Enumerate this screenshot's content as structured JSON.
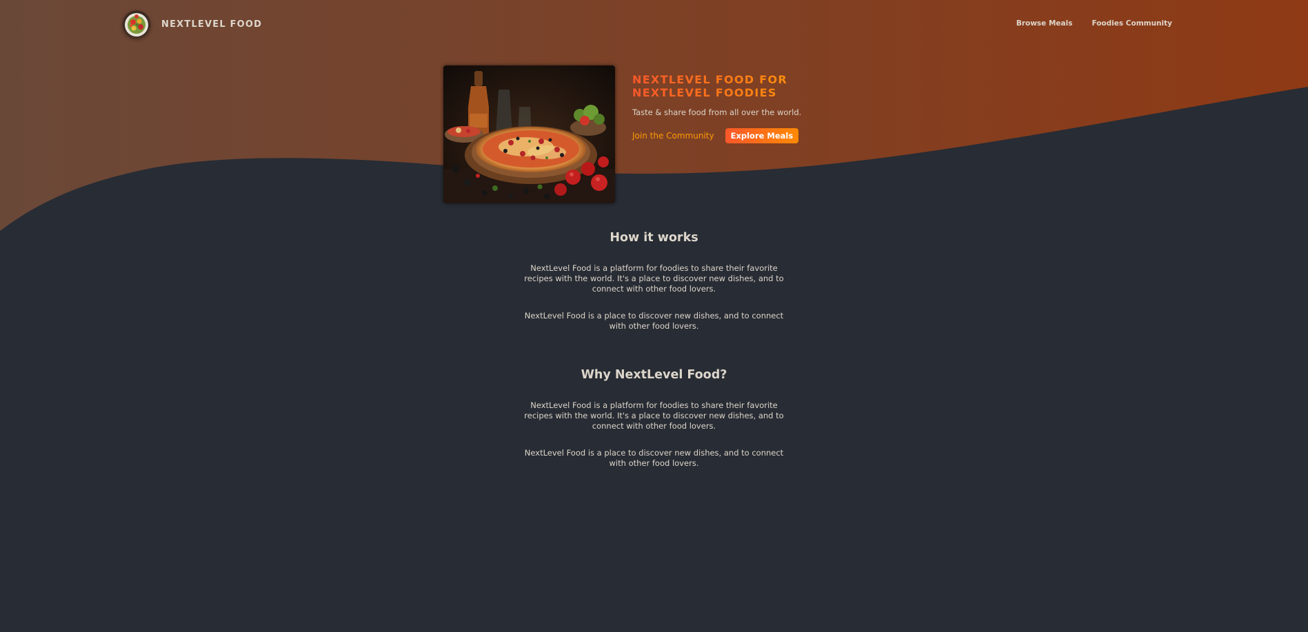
{
  "header": {
    "brand": "NextLevel Food",
    "nav": {
      "browse_meals": "Browse Meals",
      "foodies_community": "Foodies Community"
    }
  },
  "hero": {
    "title_line1": "NextLevel Food for",
    "title_line2": "NextLevel Foodies",
    "subtitle": "Taste & share food from all over the world.",
    "join_label": "Join the Community",
    "explore_label": "Explore Meals"
  },
  "sections": [
    {
      "heading": "How it works",
      "p1": "NextLevel Food is a platform for foodies to share their favorite recipes with the world. It's a place to discover new dishes, and to connect with other food lovers.",
      "p2": "NextLevel Food is a place to discover new dishes, and to connect with other food lovers."
    },
    {
      "heading": "Why NextLevel Food?",
      "p1": "NextLevel Food is a platform for foodies to share their favorite recipes with the world. It's a place to discover new dishes, and to connect with other food lovers.",
      "p2": "NextLevel Food is a place to discover new dishes, and to connect with other food lovers."
    }
  ],
  "colors": {
    "background": "#282c34",
    "header_gradient_start": "#6a4838",
    "header_gradient_end": "#8f3a15",
    "accent_start": "#f9572a",
    "accent_end": "#ff9b05",
    "text": "#ddd6cb"
  }
}
